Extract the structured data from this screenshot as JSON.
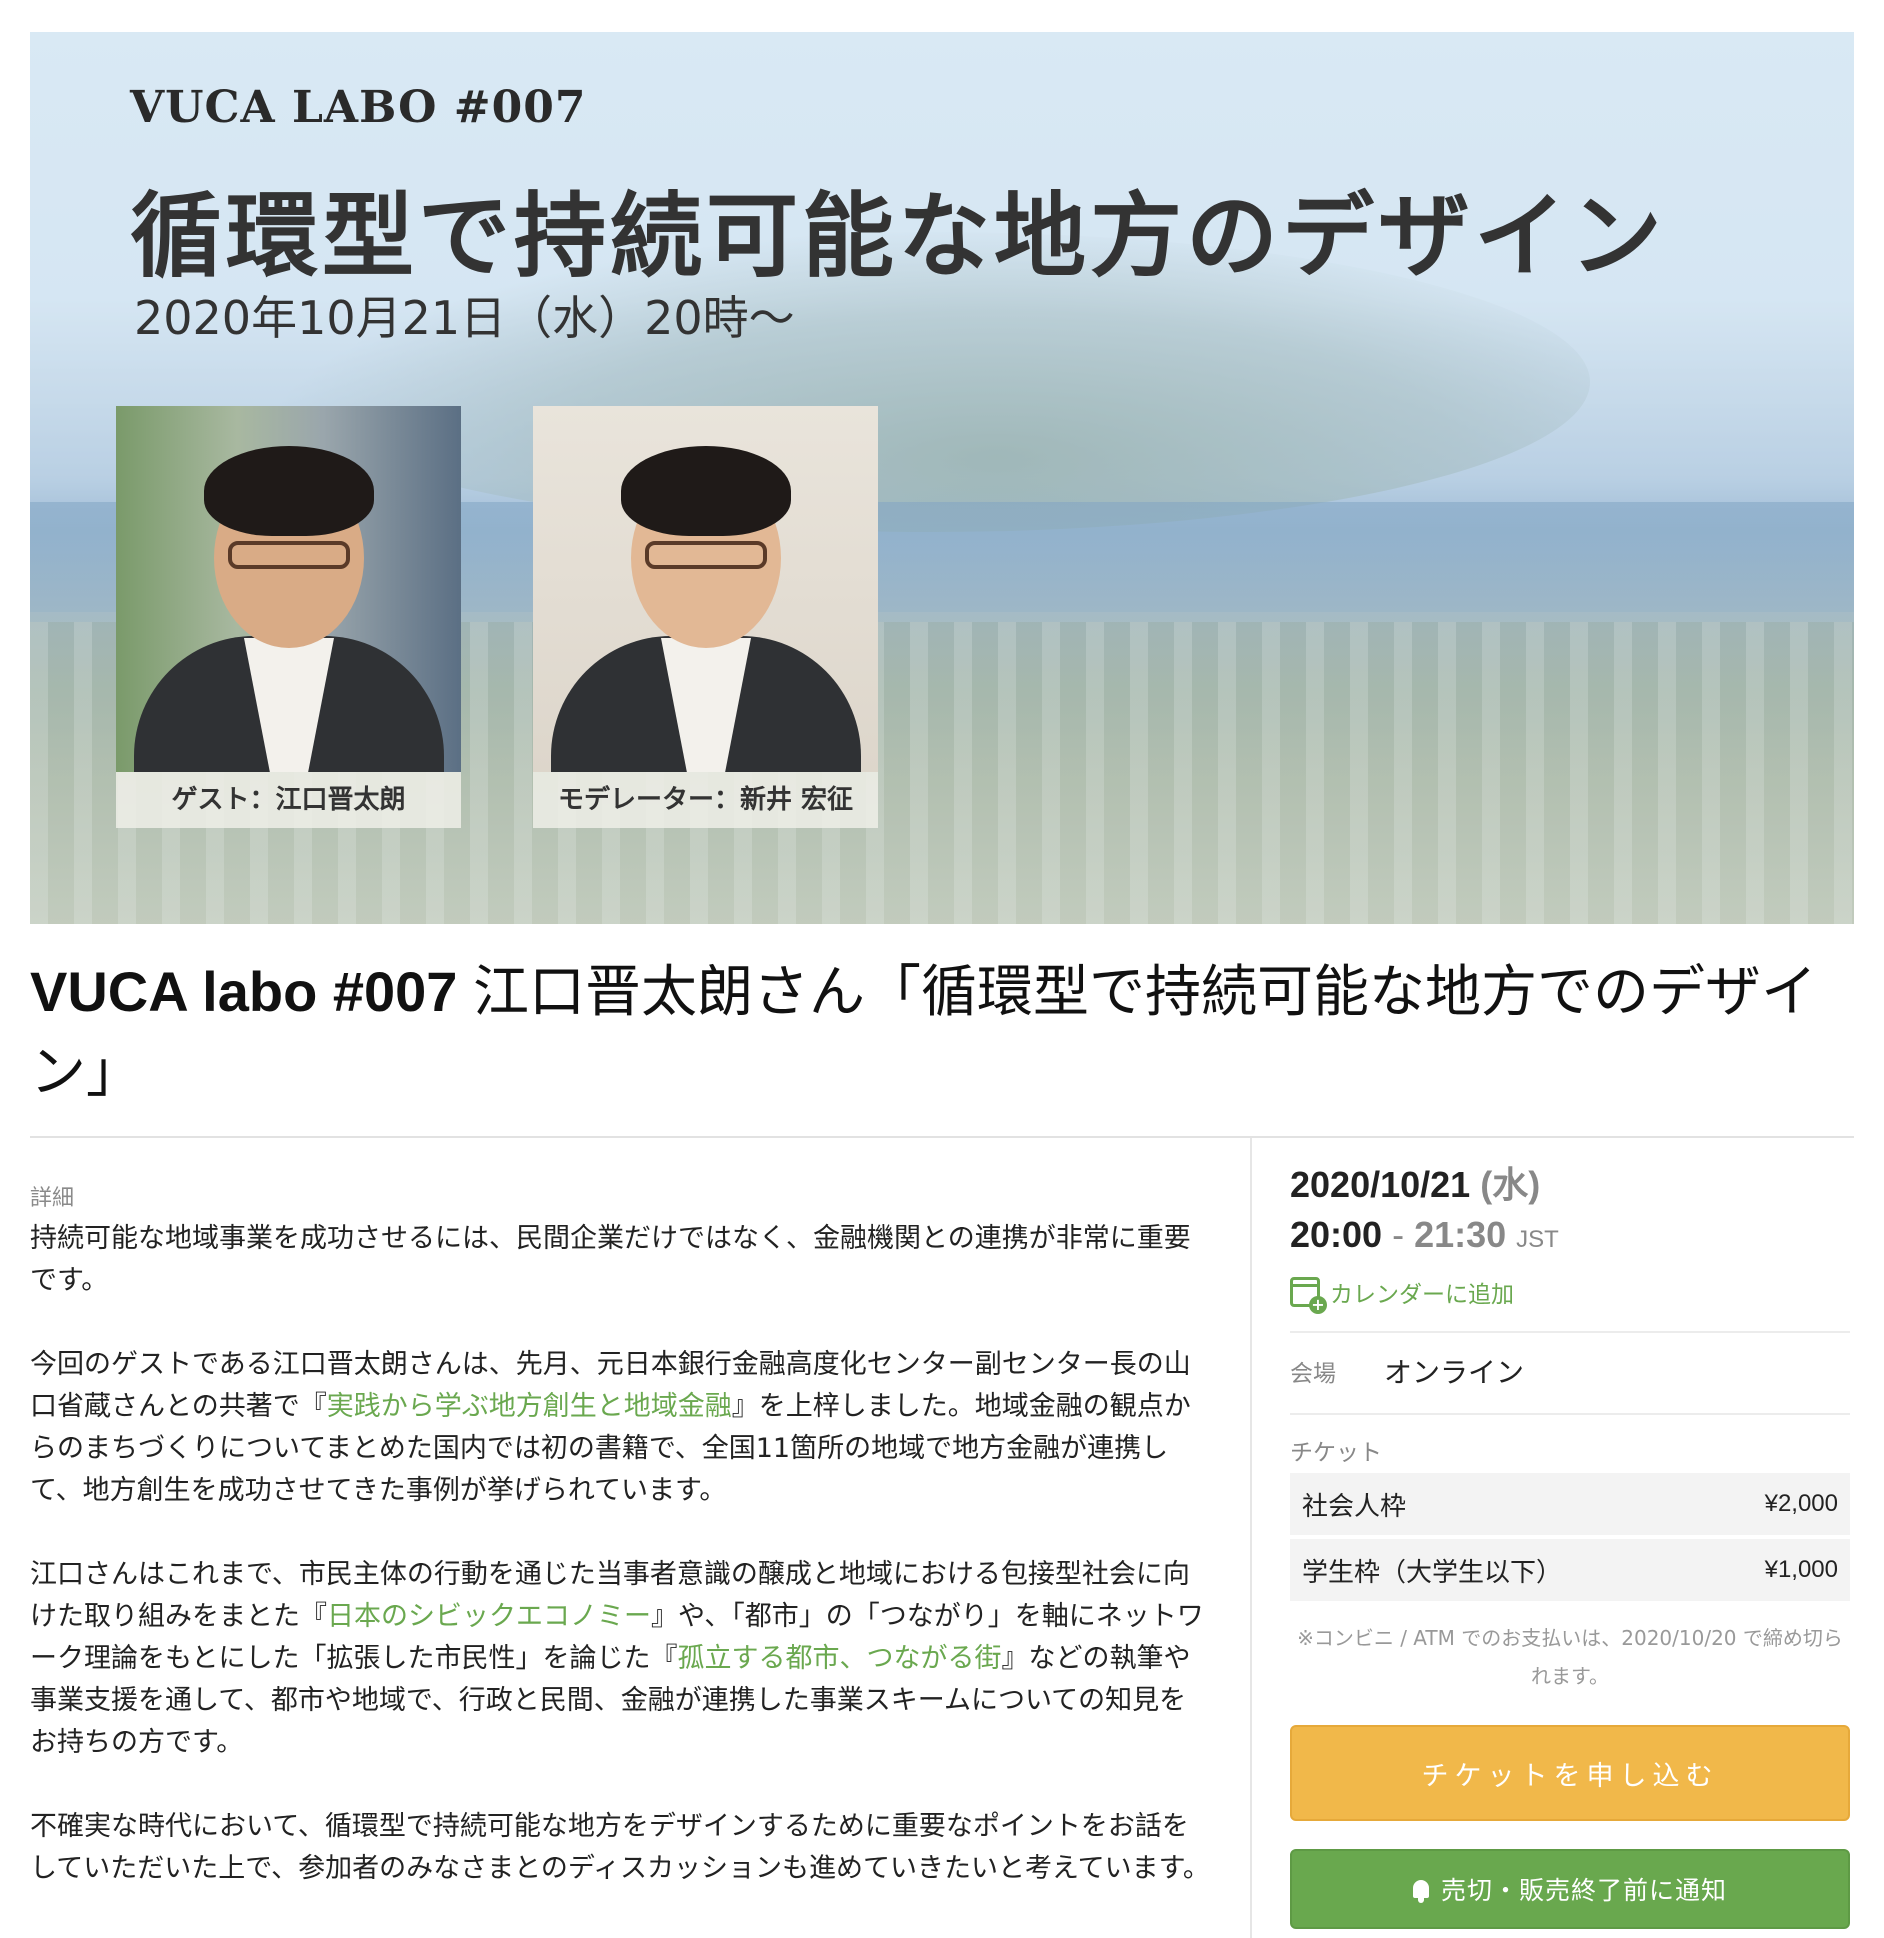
{
  "banner": {
    "kicker": "VUCA LABO #007",
    "title": "循環型で持続可能な地方のデザイン",
    "date": "2020年10月21日（水）20時〜",
    "guest_caption": "ゲスト：江口晋太朗",
    "moderator_caption": "モデレーター：新井 宏征"
  },
  "event": {
    "title_en": "VUCA labo #007",
    "title_ja": " 江口晋太朗さん「循環型で持続可能な地方でのデザイン」"
  },
  "details": {
    "label": "詳細",
    "p1": "持続可能な地域事業を成功させるには、民間企業だけではなく、金融機関との連携が非常に重要です。",
    "p2_a": "今回のゲストである江口晋太朗さんは、先月、元日本銀行金融高度化センター副センター長の山口省蔵さんとの共著で『",
    "p2_link": "実践から学ぶ地方創生と地域金融",
    "p2_b": "』を上梓しました。地域金融の観点からのまちづくりについてまとめた国内では初の書籍で、全国11箇所の地域で地方金融が連携して、地方創生を成功させてきた事例が挙げられています。",
    "p3_a": "江口さんはこれまで、市民主体の行動を通じた当事者意識の醸成と地域における包接型社会に向けた取り組みをまとた『",
    "p3_link1": "日本のシビックエコノミー",
    "p3_b": "』や、「都市」の「つながり」を軸にネットワーク理論をもとにした「拡張した市民性」を論じた『",
    "p3_link2": "孤立する都市、つながる街",
    "p3_c": "』などの執筆や事業支援を通して、都市や地域で、行政と民間、金融が連携した事業スキームについての知見をお持ちの方です。",
    "p4": "不確実な時代において、循環型で持続可能な地方をデザインするために重要なポイントをお話をしていただいた上で、参加者のみなさまとのディスカッションも進めていきたいと考えています。"
  },
  "schedule": {
    "date": "2020/10/21",
    "dow": "(水)",
    "start": "20:00",
    "sep": " - ",
    "end": "21:30",
    "tz": "JST",
    "calendar_link": "カレンダーに追加"
  },
  "venue": {
    "label": "会場",
    "value": "オンライン"
  },
  "tickets": {
    "label": "チケット",
    "items": [
      {
        "name": "社会人枠",
        "price": "¥2,000"
      },
      {
        "name": "学生枠（大学生以下）",
        "price": "¥1,000"
      }
    ],
    "note": "※コンビニ / ATM でのお支払いは、2020/10/20 で締め切られます。"
  },
  "buttons": {
    "apply": "チケットを申し込む",
    "notify": "売切・販売終了前に通知"
  },
  "colors": {
    "accent_green": "#6aa84f",
    "apply_button": "#f1b84a",
    "notify_button": "#69a84e"
  }
}
